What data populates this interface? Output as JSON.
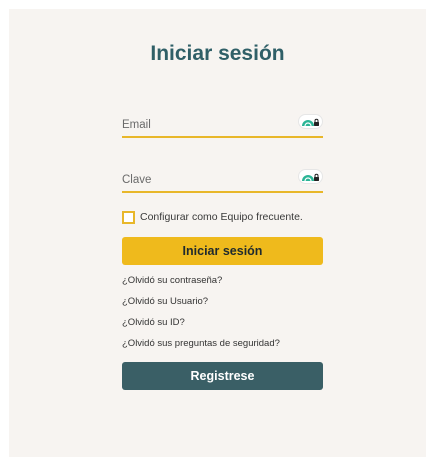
{
  "login": {
    "title": "Iniciar sesión",
    "email_placeholder": "Email",
    "password_placeholder": "Clave",
    "remember_label": "Configurar como Equipo frecuente.",
    "submit_label": "Iniciar sesión",
    "links": [
      "¿Olvidó su contraseña?",
      "¿Olvidó su Usuario?",
      "¿Olvidó su ID?",
      "¿Olvidó sus preguntas de seguridad?"
    ],
    "register_label": "Registrese"
  },
  "icons": {
    "password_toggle": "eye-lock-icon",
    "checkbox": "checkbox-unchecked-icon"
  },
  "colors": {
    "accent_yellow": "#efba1c",
    "primary_teal": "#3a5f66",
    "title_teal": "#2f5f67",
    "card_background": "#f7f4f1",
    "toggle_green": "#2bb596"
  }
}
